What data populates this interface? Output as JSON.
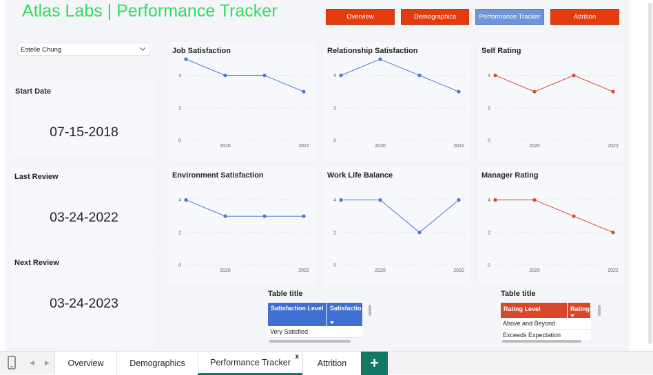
{
  "header": {
    "title": "Atlas Labs | Performance Tracker",
    "nav": [
      "Overview",
      "Demographics",
      "Performance Tracker",
      "Attrition"
    ],
    "active_nav": "Performance Tracker"
  },
  "employee_select": {
    "value": "Estelle Chung",
    "icon": "chevron-down-icon"
  },
  "dates": {
    "start_label": "Start Date",
    "start_value": "07-15-2018",
    "last_label": "Last Review",
    "last_value": "03-24-2022",
    "next_label": "Next Review",
    "next_value": "03-24-2023"
  },
  "colors": {
    "blue": "#4a78cf",
    "red": "#d9472a",
    "title_green": "#2ee05a",
    "tab_accent": "#117865"
  },
  "chart_data": [
    {
      "type": "line",
      "title": "Job Satisfaction",
      "color": "#4a78cf",
      "x": [
        2019,
        2020,
        2021,
        2022
      ],
      "y": [
        5,
        4,
        4,
        3
      ],
      "xticks": [
        2020,
        2022
      ],
      "yticks": [
        0,
        2,
        4
      ],
      "ylim": [
        0,
        5
      ]
    },
    {
      "type": "line",
      "title": "Relationship Satisfaction",
      "color": "#4a78cf",
      "x": [
        2019,
        2020,
        2021,
        2022
      ],
      "y": [
        4,
        5,
        4,
        3
      ],
      "xticks": [
        2020,
        2022
      ],
      "yticks": [
        0,
        2,
        4
      ],
      "ylim": [
        0,
        5
      ]
    },
    {
      "type": "line",
      "title": "Self Rating",
      "color": "#d9472a",
      "x": [
        2019,
        2020,
        2021,
        2022
      ],
      "y": [
        4,
        3,
        4,
        3
      ],
      "xticks": [
        2020,
        2022
      ],
      "yticks": [
        0,
        2,
        4
      ],
      "ylim": [
        0,
        5
      ]
    },
    {
      "type": "line",
      "title": "Environment Satisfaction",
      "color": "#4a78cf",
      "x": [
        2019,
        2020,
        2021,
        2022
      ],
      "y": [
        4,
        3,
        3,
        3
      ],
      "xticks": [
        2020,
        2022
      ],
      "yticks": [
        0,
        2,
        4
      ],
      "ylim": [
        0,
        5
      ]
    },
    {
      "type": "line",
      "title": "Work Life Balance",
      "color": "#4a78cf",
      "x": [
        2019,
        2020,
        2021,
        2022
      ],
      "y": [
        4,
        4,
        2,
        4
      ],
      "xticks": [
        2020,
        2022
      ],
      "yticks": [
        0,
        2,
        4
      ],
      "ylim": [
        0,
        5
      ]
    },
    {
      "type": "line",
      "title": "Manager Rating",
      "color": "#d9472a",
      "x": [
        2019,
        2020,
        2021,
        2022
      ],
      "y": [
        4,
        4,
        3,
        2
      ],
      "xticks": [
        2020,
        2022
      ],
      "yticks": [
        0,
        2,
        4
      ],
      "ylim": [
        0,
        5
      ]
    }
  ],
  "tables": [
    {
      "title": "Table title",
      "header_color": "#3f6fd1",
      "columns": [
        "Satisfaction Level",
        "Satisfactio"
      ],
      "rows": [
        "Very Satisfied"
      ]
    },
    {
      "title": "Table title",
      "header_color": "#d9472a",
      "columns": [
        "Rating Level",
        "Rating"
      ],
      "rows": [
        "Above and Beyond",
        "Exceeds Expectation"
      ]
    }
  ],
  "tabbar": {
    "tabs": [
      "Overview",
      "Demographics",
      "Performance Tracker",
      "Attrition"
    ],
    "active": "Performance Tracker",
    "close_label": "x",
    "add_label": "+"
  }
}
